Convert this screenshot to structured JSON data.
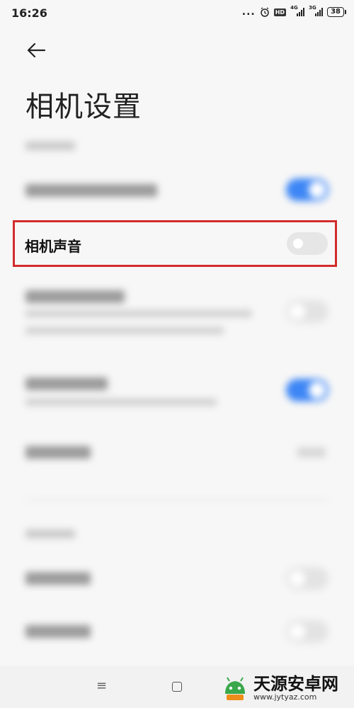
{
  "status_bar": {
    "time": "16:26",
    "dots": "...",
    "hd": "HD",
    "sim1": "4G",
    "sim2": "3G",
    "battery": "38"
  },
  "header": {
    "title": "相机设置"
  },
  "highlighted_row": {
    "label": "相机声音",
    "switch_on": false
  },
  "colors": {
    "accent": "#3d86f5",
    "highlight_border": "#d32b2b"
  },
  "navbar": {
    "menu_glyph": "≡"
  },
  "watermark": {
    "name": "天源安卓网",
    "url": "www.jytyaz.com"
  }
}
